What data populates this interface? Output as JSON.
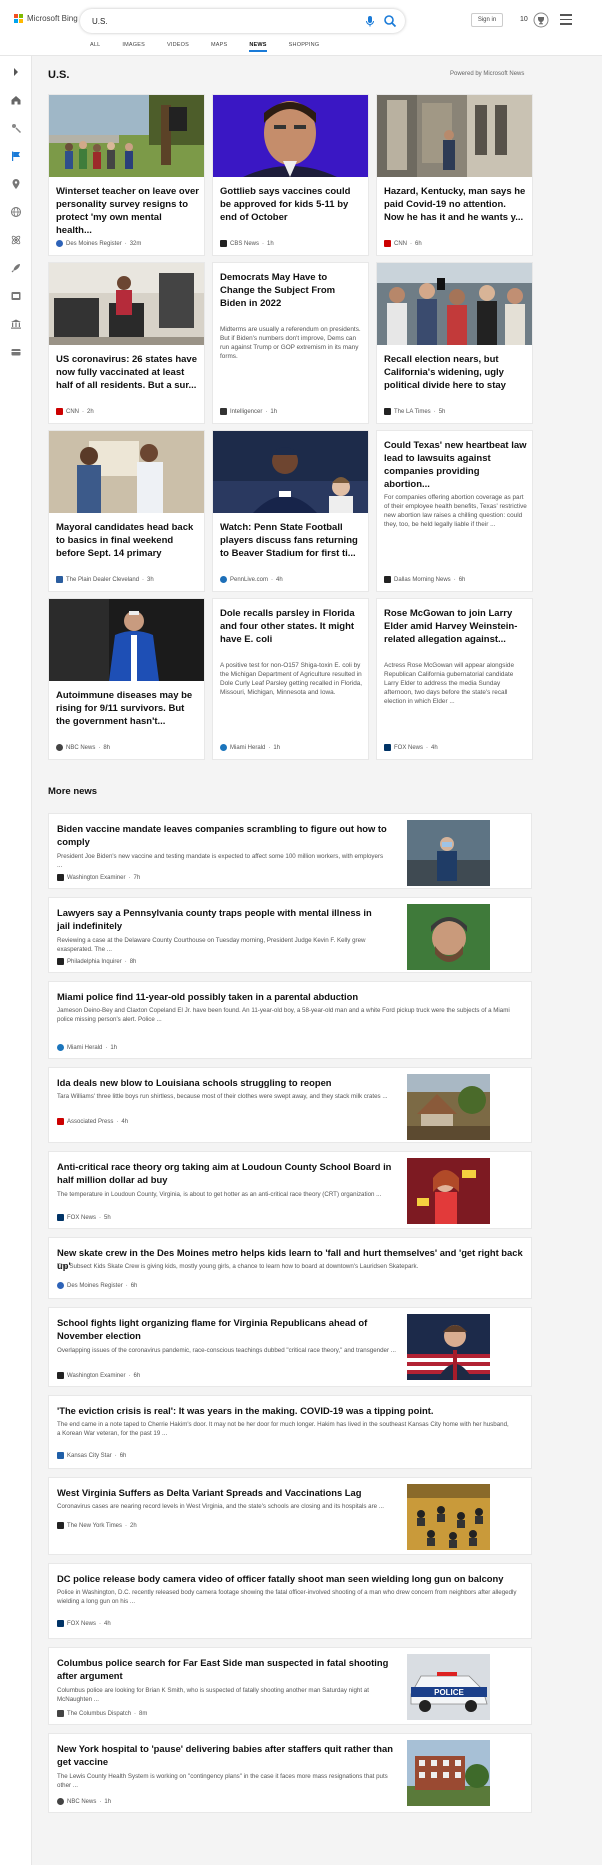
{
  "brand": {
    "name": "Microsoft Bing"
  },
  "search": {
    "query": "U.S."
  },
  "header": {
    "signin_label": "Sign in",
    "rewards_count": "10"
  },
  "tabs": [
    {
      "label": "ALL"
    },
    {
      "label": "IMAGES"
    },
    {
      "label": "VIDEOS"
    },
    {
      "label": "MAPS"
    },
    {
      "label": "NEWS"
    },
    {
      "label": "SHOPPING"
    }
  ],
  "section": {
    "title": "U.S.",
    "powered_by": "Powered by Microsoft News"
  },
  "rail_icons": [
    "expand-icon",
    "home-icon",
    "sports-icon",
    "flag-icon",
    "location-icon",
    "globe-icon",
    "science-icon",
    "rocket-icon",
    "entertainment-icon",
    "money-icon",
    "wallet-icon"
  ],
  "cards": [
    {
      "title": "Winterset teacher on leave over personality survey resigns to protect 'my own mental health...",
      "source": "Des Moines Register",
      "time": "32m",
      "logo_color": "#2e63b8"
    },
    {
      "title": "Gottlieb says vaccines could be approved for kids 5-11 by end of October",
      "source": "CBS News",
      "time": "1h",
      "logo_color": "#222222"
    },
    {
      "title": "Hazard, Kentucky, man says he paid Covid-19 no attention. Now he has it and he wants y...",
      "source": "CNN",
      "time": "6h",
      "logo_color": "#cc0000"
    },
    {
      "title": "US coronavirus: 26 states have now fully vaccinated at least half of all residents. But a sur...",
      "source": "CNN",
      "time": "2h",
      "logo_color": "#cc0000"
    },
    {
      "title": "Democrats May Have to Change the Subject From Biden in 2022",
      "desc": "Midterms are usually a referendum on presidents. But if Biden's numbers don't improve, Dems can run against Trump or GOP extremism in its many forms.",
      "source": "Intelligencer",
      "time": "1h",
      "logo_color": "#333333"
    },
    {
      "title": "Recall election nears, but California's widening, ugly political divide here to stay",
      "source": "The LA Times",
      "time": "5h",
      "logo_color": "#222222"
    },
    {
      "title": "Mayoral candidates head back to basics in final weekend before Sept. 14 primary",
      "source": "The Plain Dealer Cleveland",
      "time": "3h",
      "logo_color": "#2a5d9f"
    },
    {
      "title": "Watch: Penn State Football players discuss fans returning to Beaver Stadium for first ti...",
      "source": "PennLive.com",
      "time": "4h",
      "logo_color": "#1d6fb8"
    },
    {
      "title": "Could Texas' new heartbeat law lead to lawsuits against companies providing abortion...",
      "desc": "For companies offering abortion coverage as part of their employee health benefits, Texas' restrictive new abortion law raises a chilling question: could they, too, be held legally liable if their ...",
      "source": "Dallas Morning News",
      "time": "6h",
      "logo_color": "#222222"
    },
    {
      "title": "Autoimmune diseases may be rising for 9/11 survivors. But the government hasn't...",
      "source": "NBC News",
      "time": "8h",
      "logo_color": "#444444"
    },
    {
      "title": "Dole recalls parsley in Florida and four other states. It might have E. coli",
      "desc": "A positive test for non-O157 Shiga-toxin E. coli by the Michigan Department of Agriculture resulted in Dole Curly Leaf Parsley getting recalled in Florida, Missouri, Michigan, Minnesota and Iowa.",
      "source": "Miami Herald",
      "time": "1h",
      "logo_color": "#1b75bc"
    },
    {
      "title": "Rose McGowan to join Larry Elder amid Harvey Weinstein-related allegation against...",
      "desc": "Actress Rose McGowan will appear alongside Republican California gubernatorial candidate Larry Elder to address the media Sunday afternoon, two days before the state's recall election in which Elder ...",
      "source": "FOX News",
      "time": "4h",
      "logo_color": "#003366"
    }
  ],
  "more_news": {
    "title": "More news",
    "items": [
      {
        "title": "Biden vaccine mandate leaves companies scrambling to figure out how to comply",
        "desc": "President Joe Biden's new vaccine and testing mandate is expected to affect some 100 million workers, with employers ...",
        "source": "Washington Examiner",
        "time": "7h",
        "logo_color": "#222222"
      },
      {
        "title": "Lawyers say a Pennsylvania county traps people with mental illness in jail indefinitely",
        "desc": "Reviewing a case at the Delaware County Courthouse on Tuesday morning, President Judge Kevin F. Kelly grew exasperated. The ...",
        "source": "Philadelphia Inquirer",
        "time": "8h",
        "logo_color": "#222222"
      },
      {
        "title": "Miami police find 11-year-old possibly taken in a parental abduction",
        "desc": "Jameson Deino-Bey and Claxton Copeland El Jr. have been found. An 11-year-old boy, a 58-year-old man and a white Ford pickup truck were the subjects of a Miami police missing person's alert. Police ...",
        "source": "Miami Herald",
        "time": "1h",
        "logo_color": "#1b75bc"
      },
      {
        "title": "Ida deals new blow to Louisiana schools struggling to reopen",
        "desc": "Tara Williams' three little boys run shirtless, because most of their clothes were swept away, and they stack milk crates ...",
        "source": "Associated Press",
        "time": "4h",
        "logo_color": "#cc0000"
      },
      {
        "title": "Anti-critical race theory org taking aim at Loudoun County School Board in half million dollar ad buy",
        "desc": "The temperature in Loudoun County, Virginia, is about to get hotter as an anti-critical race theory (CRT) organization ...",
        "source": "FOX News",
        "time": "5h",
        "logo_color": "#003366"
      },
      {
        "title": "New skate crew in the Des Moines metro helps kids learn to 'fall and hurt themselves' and 'get right back up'",
        "desc": "The Subsect Kids Skate Crew is giving kids, mostly young girls, a chance to learn how to board at downtown's Lauridsen Skatepark.",
        "source": "Des Moines Register",
        "time": "6h",
        "logo_color": "#2e63b8"
      },
      {
        "title": "School fights light organizing flame for Virginia Republicans ahead of November election",
        "desc": "Overlapping issues of the coronavirus pandemic, race-conscious teachings dubbed \"critical race theory,\" and transgender ...",
        "source": "Washington Examiner",
        "time": "6h",
        "logo_color": "#222222"
      },
      {
        "title": "'The eviction crisis is real': It was years in the making. COVID-19 was a tipping point.",
        "desc": "The end came in a note taped to Cherrie Hakim's door. It may not be her door for much longer. Hakim has lived in the southeast Kansas City home with her husband, a Korean War veteran, for the past 19 ...",
        "source": "Kansas City Star",
        "time": "6h",
        "logo_color": "#1f5fa8"
      },
      {
        "title": "West Virginia Suffers as Delta Variant Spreads and Vaccinations Lag",
        "desc": "Coronavirus cases are nearing record levels in West Virginia, and the state's schools are closing and its hospitals are ...",
        "source": "The New York Times",
        "time": "2h",
        "logo_color": "#222222"
      },
      {
        "title": "DC police release body camera video of officer fatally shoot man seen wielding long gun on balcony",
        "desc": "Police in Washington, D.C. recently released body camera footage showing the fatal officer-involved shooting of a man who drew concern from neighbors after allegedly wielding a long gun on his ...",
        "source": "FOX News",
        "time": "4h",
        "logo_color": "#003366"
      },
      {
        "title": "Columbus police search for Far East Side man suspected in fatal shooting after argument",
        "desc": "Columbus police are looking for Brian K Smith, who is suspected of fatally shooting another man Saturday night at McNaughten ...",
        "source": "The Columbus Dispatch",
        "time": "8m",
        "logo_color": "#444444"
      },
      {
        "title": "New York hospital to 'pause' delivering babies after staffers quit rather than get vaccine",
        "desc": "The Lewis County Health System is working on \"contingency plans\" in the case it faces more mass resignations that puts other ...",
        "source": "NBC News",
        "time": "1h",
        "logo_color": "#444444"
      }
    ]
  },
  "photo_text": {
    "police_car": "POLICE"
  }
}
